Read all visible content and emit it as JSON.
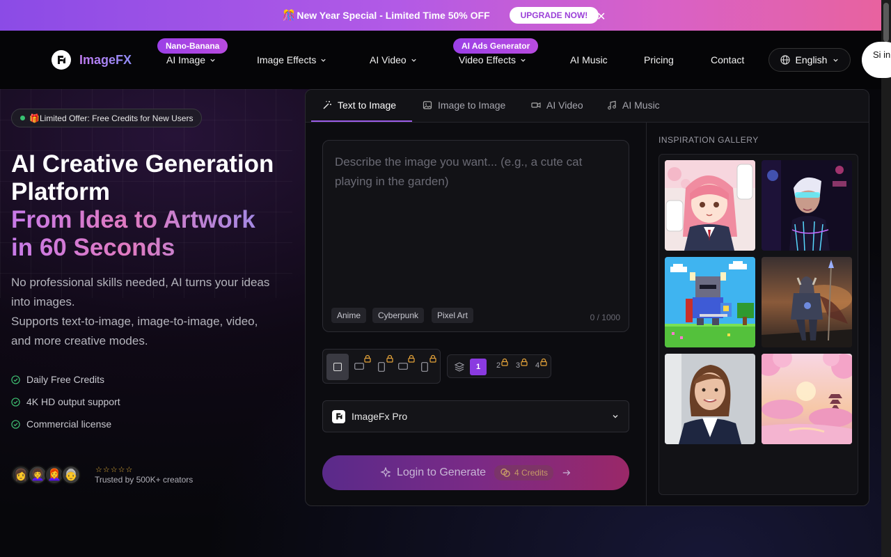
{
  "promo": {
    "text": "New Year Special - Limited Time 50% OFF",
    "upgrade_label": "UPGRADE NOW!"
  },
  "nav": {
    "brand": "ImageFX",
    "items": [
      {
        "label": "AI Image",
        "badge": "Nano-Banana"
      },
      {
        "label": "Image Effects"
      },
      {
        "label": "AI Video"
      },
      {
        "label": "Video Effects",
        "badge": "AI Ads Generator"
      },
      {
        "label": "AI Music"
      },
      {
        "label": "Pricing"
      },
      {
        "label": "Contact"
      }
    ],
    "language": "English",
    "signin_label": "Si in"
  },
  "hero": {
    "offer": "🎁Limited Offer: Free Credits for New Users",
    "title_line1": "AI Creative Generation",
    "title_line2": "Platform",
    "title_grad_line1": "From Idea to Artwork",
    "title_grad_line2": "in 60 Seconds",
    "desc_line1": "No professional skills needed, AI turns your ideas into images.",
    "desc_line2": "Supports text-to-image, image-to-image, video, and more creative modes.",
    "features": [
      "Daily Free Credits",
      "4K HD output support",
      "Commercial license"
    ],
    "stars": "☆☆☆☆☆",
    "trusted": "Trusted by 500K+ creators"
  },
  "panel": {
    "tabs": [
      "Text to Image",
      "Image to Image",
      "AI Video",
      "AI Music"
    ],
    "prompt_placeholder": "Describe the image you want... (e.g., a cute cat playing in the garden)",
    "chips": [
      "Anime",
      "Cyberpunk",
      "Pixel Art"
    ],
    "counter": "0 / 1000",
    "count_options": [
      "1",
      "2",
      "3",
      "4"
    ],
    "model": "ImageFx Pro",
    "generate_label": "Login to Generate",
    "credits": "4 Credits",
    "gallery_title": "INSPIRATION GALLERY"
  },
  "colors": {
    "accent": "#9b5ce8",
    "lock": "#e8a53a"
  }
}
